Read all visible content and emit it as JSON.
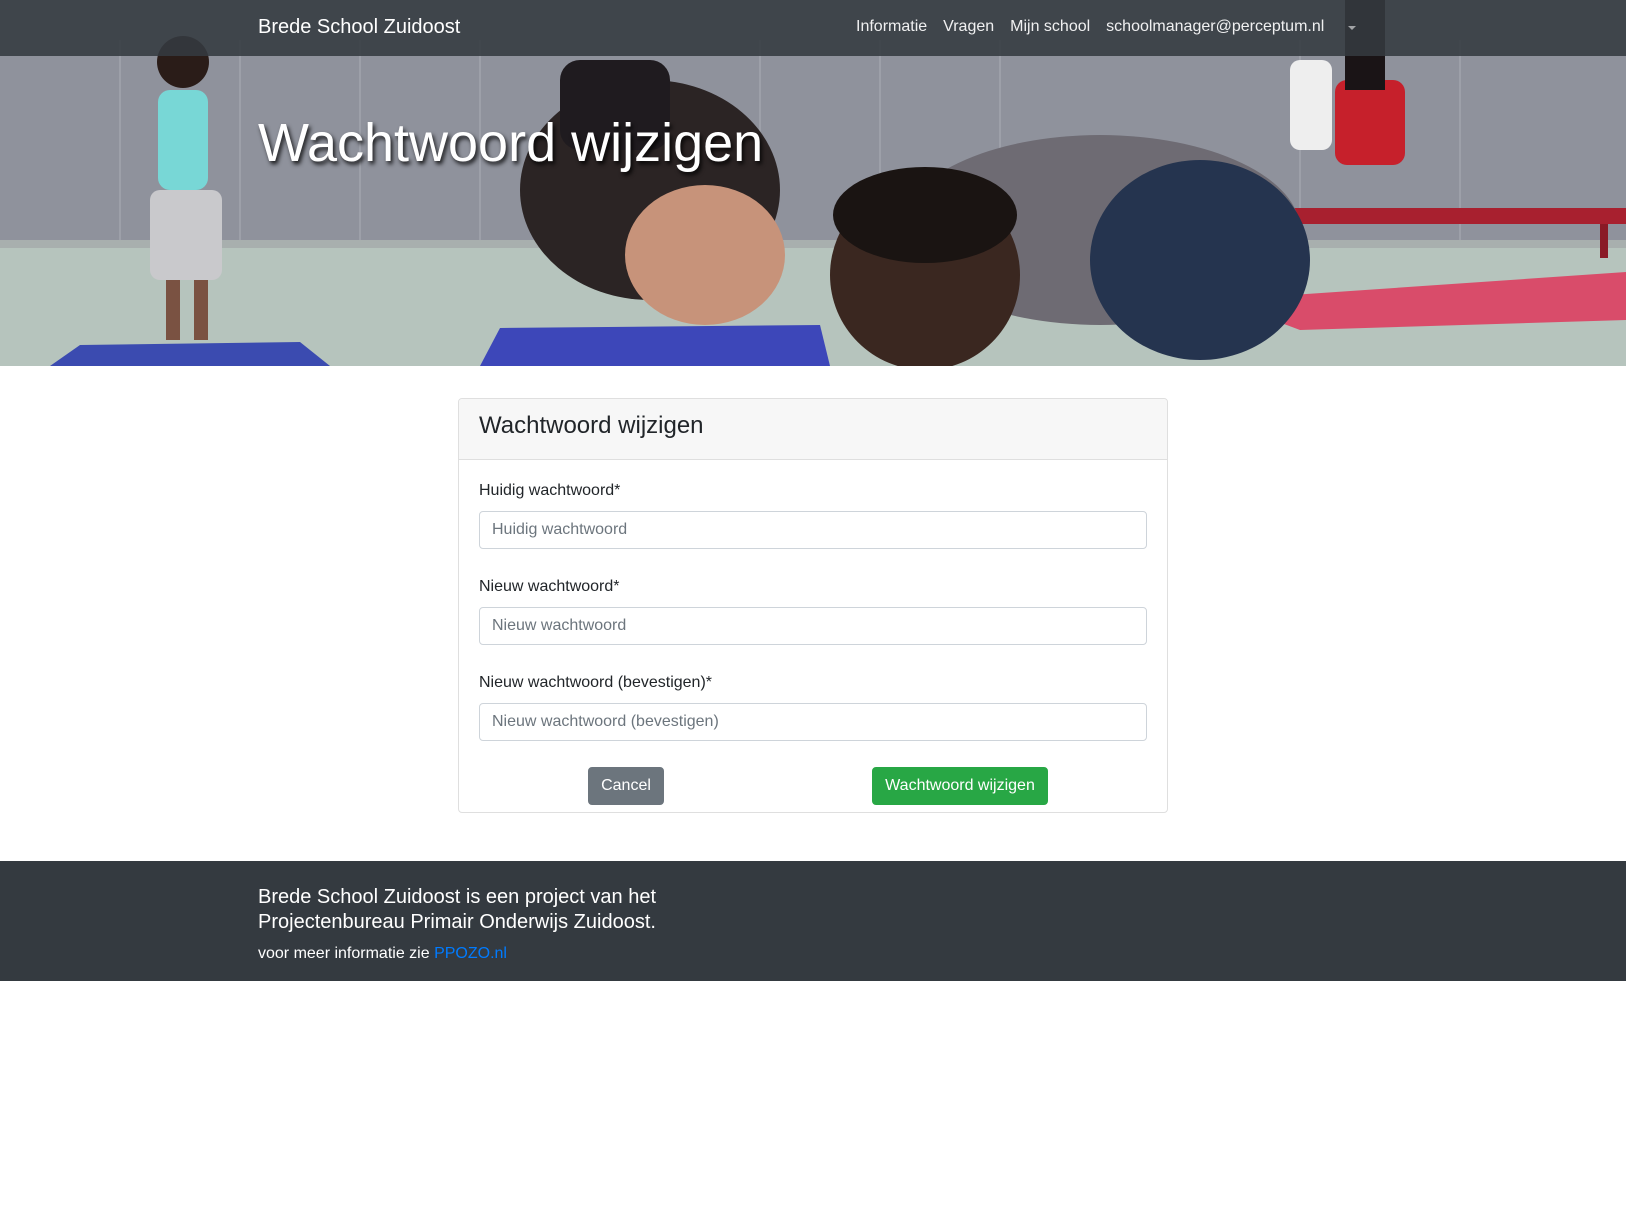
{
  "navbar": {
    "brand": "Brede School Zuidoost",
    "links": [
      {
        "label": "Informatie"
      },
      {
        "label": "Vragen"
      },
      {
        "label": "Mijn school"
      },
      {
        "label": "schoolmanager@perceptum.nl"
      }
    ],
    "dropdown_icon": "caret-down-icon"
  },
  "hero": {
    "title": "Wachtwoord wijzigen"
  },
  "form": {
    "title": "Wachtwoord wijzigen",
    "current_password": {
      "label": "Huidig wachtwoord*",
      "placeholder": "Huidig wachtwoord",
      "value": ""
    },
    "new_password": {
      "label": "Nieuw wachtwoord*",
      "placeholder": "Nieuw wachtwoord",
      "value": ""
    },
    "confirm_password": {
      "label": "Nieuw wachtwoord (bevestigen)*",
      "placeholder": "Nieuw wachtwoord (bevestigen)",
      "value": ""
    },
    "cancel_label": "Cancel",
    "submit_label": "Wachtwoord wijzigen"
  },
  "footer": {
    "lead": "Brede School Zuidoost is een project van het Projectenbureau Primair Onderwijs Zuidoost.",
    "info_text": "voor meer informatie zie ",
    "link_label": "PPOZO.nl"
  },
  "colors": {
    "navbar_bg": "#343a40",
    "footer_bg": "#343a40",
    "submit_button": "#28a745",
    "cancel_button": "#6c757d",
    "link": "#007bff"
  }
}
